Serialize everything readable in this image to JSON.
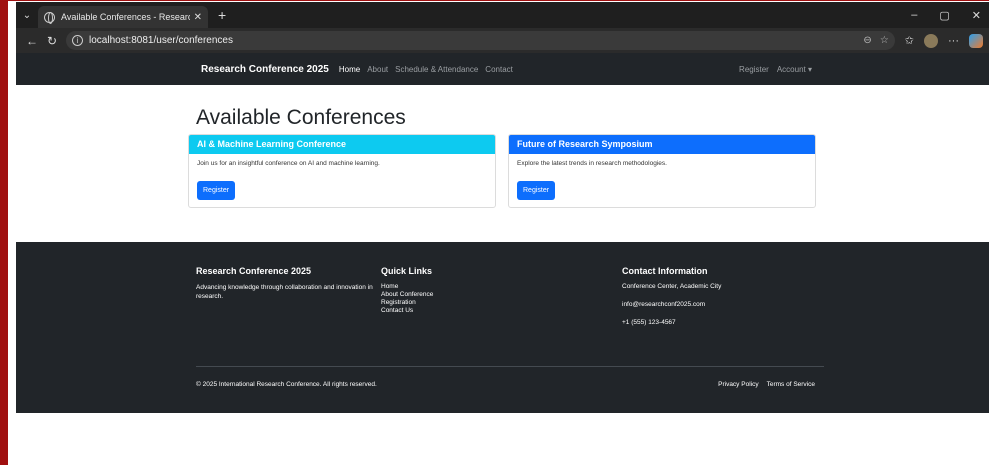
{
  "browser": {
    "tab_title": "Available Conferences - Research C",
    "tab_close": "✕",
    "new_tab": "+",
    "url": "localhost:8081/user/conferences",
    "minimize": "–",
    "maximize": "▢",
    "close": "✕"
  },
  "navbar": {
    "brand": "Research Conference 2025",
    "links": [
      {
        "label": "Home",
        "active": true
      },
      {
        "label": "About"
      },
      {
        "label": "Schedule & Attendance"
      },
      {
        "label": "Contact"
      }
    ],
    "register": "Register",
    "account": "Account ▾"
  },
  "main": {
    "heading": "Available Conferences",
    "cards": [
      {
        "title": "AI & Machine Learning Conference",
        "header_color": "#0dcaf0",
        "text": "Join us for an insightful conference on AI and machine learning.",
        "button": "Register"
      },
      {
        "title": "Future of Research Symposium",
        "header_color": "#0d6efd",
        "text": "Explore the latest trends in research methodologies.",
        "button": "Register"
      }
    ]
  },
  "footer": {
    "about_title": "Research Conference 2025",
    "about_text": "Advancing knowledge through collaboration and innovation in research.",
    "links_title": "Quick Links",
    "links": [
      "Home",
      "About Conference",
      "Registration",
      "Contact Us"
    ],
    "contact_title": "Contact Information",
    "address": "Conference Center, Academic City",
    "email": "info@researchconf2025.com",
    "phone": "+1 (555) 123-4567",
    "copyright": "© 2025 International Research Conference. All rights reserved.",
    "privacy": "Privacy Policy",
    "terms": "Terms of Service"
  }
}
